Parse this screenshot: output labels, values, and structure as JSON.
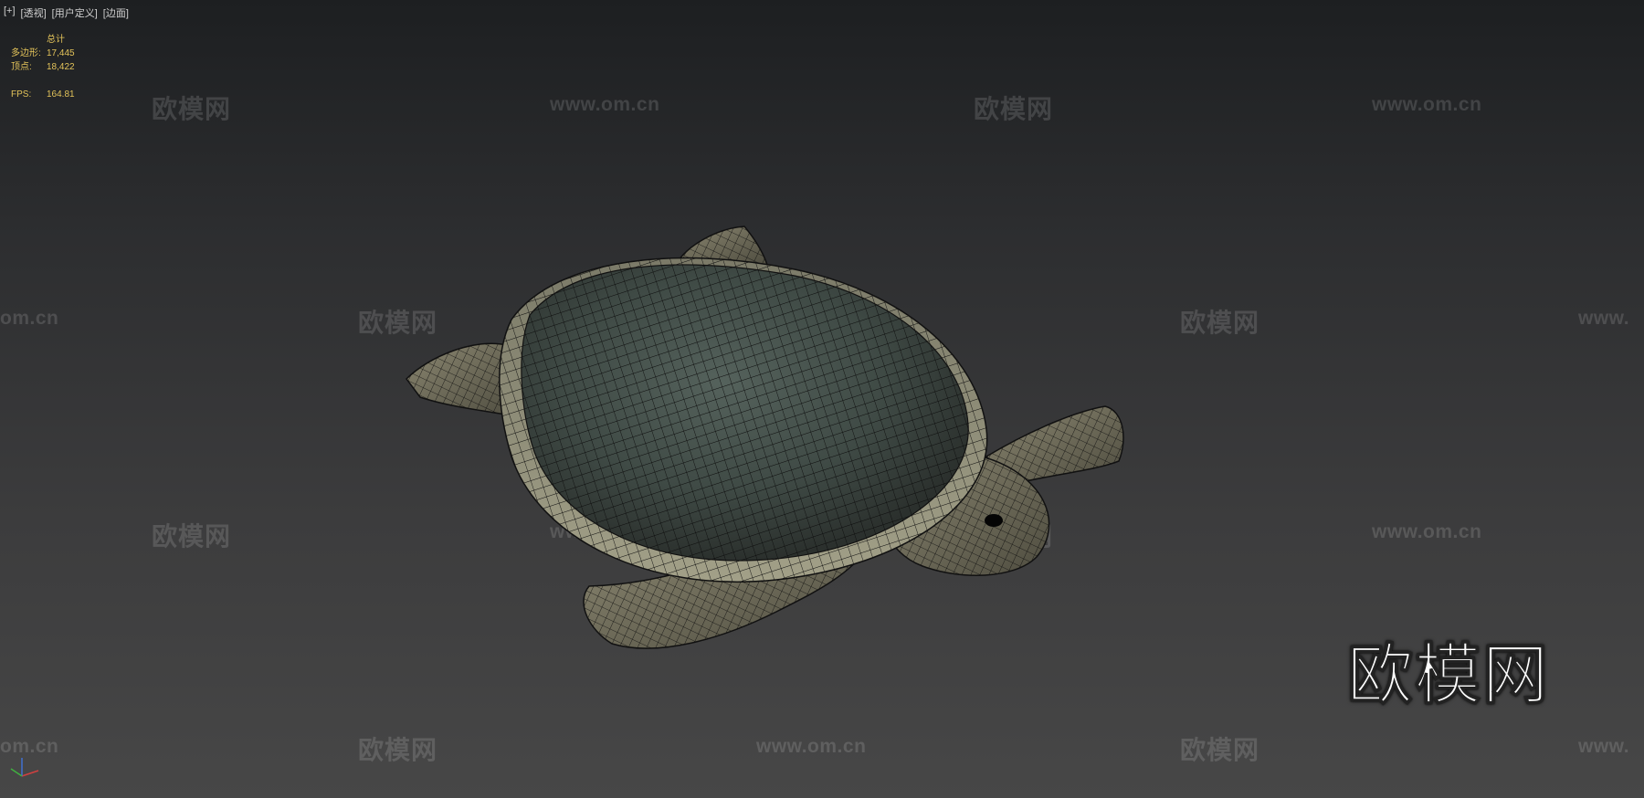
{
  "viewport": {
    "menu": [
      "[+]",
      "[透视]",
      "[用户定义]",
      "[边面]"
    ]
  },
  "stats": {
    "header": "总计",
    "polys_label": "多边形:",
    "polys_value": "17,445",
    "verts_label": "顶点:",
    "verts_value": "18,422",
    "fps_label": "FPS:",
    "fps_value": "164.81"
  },
  "watermarks": {
    "logo": "欧模网",
    "url": "www.om.cn",
    "url_partial_left": "om.cn",
    "url_partial_right": "www."
  },
  "big_logo": "欧模网",
  "colors": {
    "stats_text": "#e3c35a",
    "shell": "#49564f",
    "skin": "#6b6a5a"
  }
}
